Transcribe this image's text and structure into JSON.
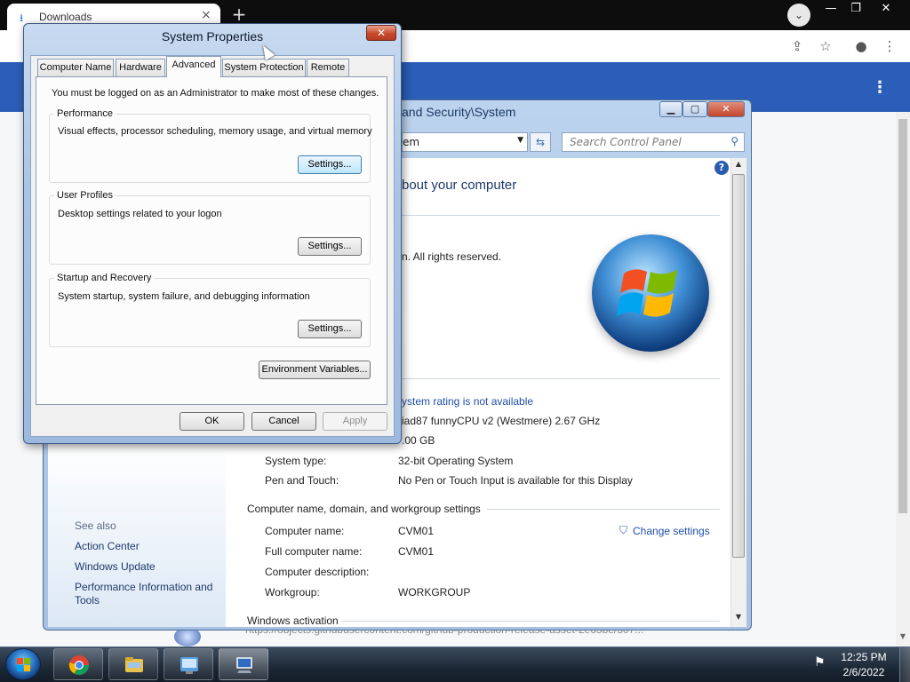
{
  "browser": {
    "tab_title": "Downloads",
    "tab_close": "×",
    "new_tab": "+",
    "url_status": "https://objects.githubusercontent.com/github-production-release-asset-2e65be/307...",
    "window_controls": {
      "minimize": "—",
      "restore": "❐",
      "close": "✕"
    }
  },
  "control_panel": {
    "title_path": "and Security\\System",
    "address_value": "em",
    "search_placeholder": "Search Control Panel",
    "heading": "bout your computer",
    "copyright": "n. All rights reserved.",
    "rating_link": "ystem rating is not available",
    "processor_value": "iad87 funnyCPU v2 (Westmere)   2.67 GHz",
    "memory_value": ".00 GB",
    "rows": [
      {
        "label": "System type:",
        "value": "32-bit Operating System"
      },
      {
        "label": "Pen and Touch:",
        "value": "No Pen or Touch Input is available for this Display"
      }
    ],
    "computer_section_title": "Computer name, domain, and workgroup settings",
    "change_settings": "Change settings",
    "computer_rows": [
      {
        "label": "Computer name:",
        "value": "CVM01"
      },
      {
        "label": "Full computer name:",
        "value": "CVM01"
      },
      {
        "label": "Computer description:",
        "value": ""
      },
      {
        "label": "Workgroup:",
        "value": "WORKGROUP"
      }
    ],
    "activation_title": "Windows activation",
    "see_also_title": "See also",
    "see_also": [
      "Action Center",
      "Windows Update",
      "Performance Information and",
      "Tools"
    ]
  },
  "system_properties": {
    "title": "System Properties",
    "tabs": [
      "Computer Name",
      "Hardware",
      "Advanced",
      "System Protection",
      "Remote"
    ],
    "active_tab": "Advanced",
    "admin_note": "You must be logged on as an Administrator to make most of these changes.",
    "groups": [
      {
        "title": "Performance",
        "desc": "Visual effects, processor scheduling, memory usage, and virtual memory",
        "button": "Settings..."
      },
      {
        "title": "User Profiles",
        "desc": "Desktop settings related to your logon",
        "button": "Settings..."
      },
      {
        "title": "Startup and Recovery",
        "desc": "System startup, system failure, and debugging information",
        "button": "Settings..."
      }
    ],
    "env_button": "Environment Variables...",
    "ok": "OK",
    "cancel": "Cancel",
    "apply": "Apply"
  },
  "taskbar": {
    "time": "12:25 PM",
    "date": "2/6/2022"
  }
}
